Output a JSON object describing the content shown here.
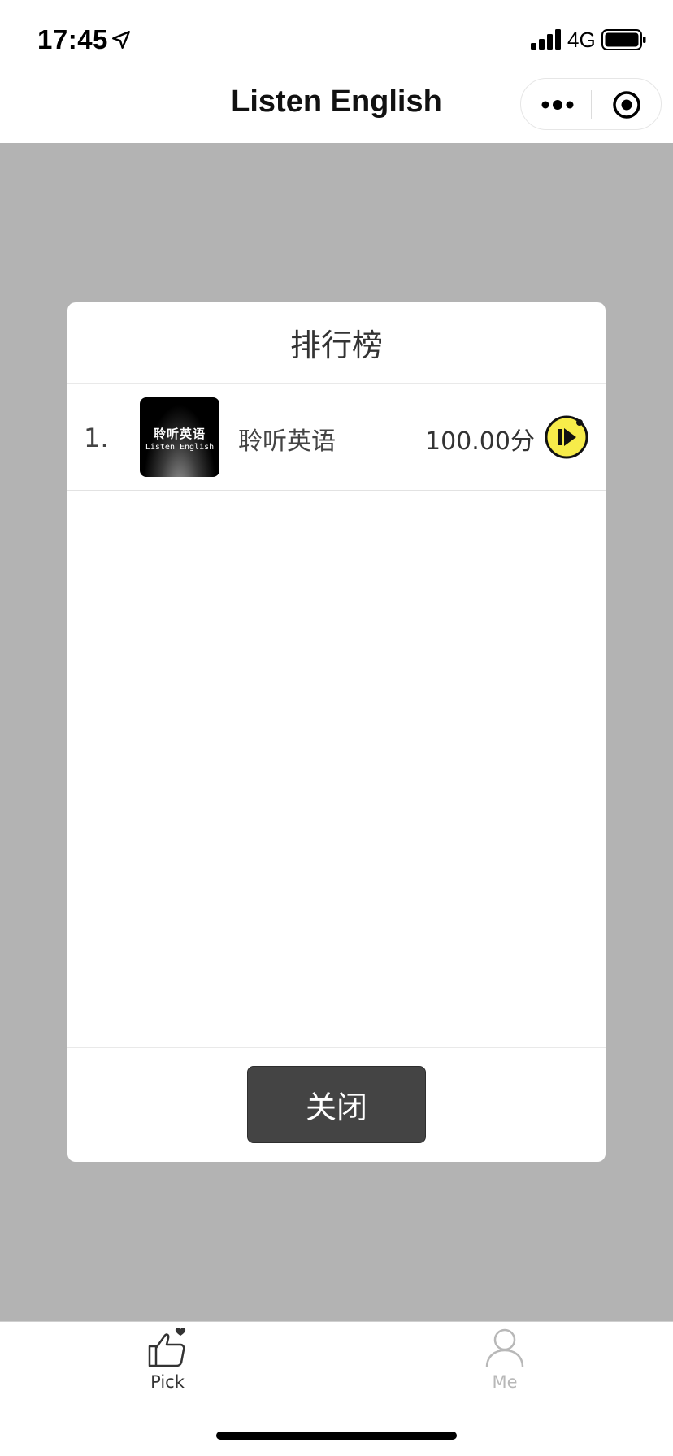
{
  "status_bar": {
    "time": "17:45",
    "network": "4G",
    "icons": [
      "location-arrow-icon",
      "signal-bars-icon",
      "battery-icon"
    ]
  },
  "nav": {
    "title": "Listen English",
    "icons": [
      "more-dots-icon",
      "target-icon"
    ]
  },
  "modal": {
    "title": "排行榜",
    "rows": [
      {
        "rank": "1.",
        "logo_text_cn": "聆听英语",
        "logo_text_en": "Listen English",
        "name": "聆听英语",
        "score": "100.00分",
        "action_icon": "play-icon"
      }
    ],
    "close_label": "关闭"
  },
  "tab_bar": {
    "tabs": [
      {
        "label": "Pick",
        "icon": "thumbs-up-icon",
        "active": true
      },
      {
        "label": "Me",
        "icon": "person-icon",
        "active": false
      }
    ]
  },
  "colors": {
    "overlay": "#b3b3b3",
    "accent_yellow": "#f7ec4a",
    "button_dark": "#444444",
    "inactive_tab": "#b8b8b8"
  }
}
